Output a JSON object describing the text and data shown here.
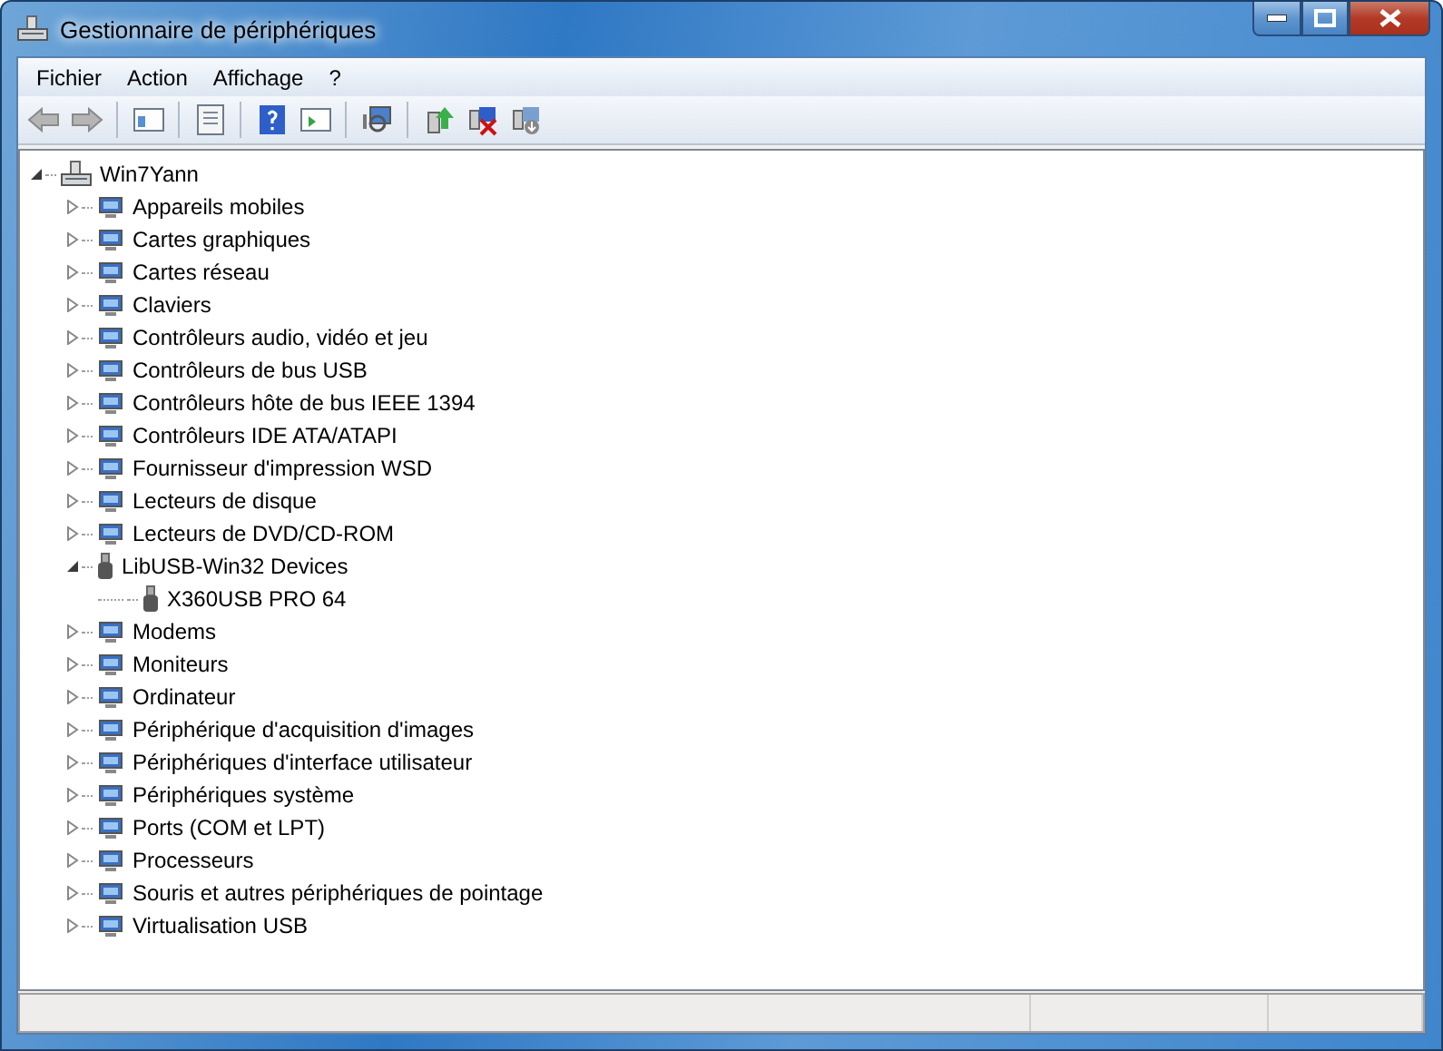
{
  "window": {
    "title": "Gestionnaire de périphériques"
  },
  "menu": [
    {
      "label": "Fichier"
    },
    {
      "label": "Action"
    },
    {
      "label": "Affichage"
    },
    {
      "label": "?"
    }
  ],
  "tree": [
    {
      "label": "Win7Yann",
      "expanded": true,
      "children": [
        {
          "label": "Appareils mobiles",
          "expanded": false
        },
        {
          "label": "Cartes graphiques",
          "expanded": false
        },
        {
          "label": "Cartes réseau",
          "expanded": false
        },
        {
          "label": "Claviers",
          "expanded": false
        },
        {
          "label": "Contrôleurs audio, vidéo et jeu",
          "expanded": false
        },
        {
          "label": "Contrôleurs de bus USB",
          "expanded": false
        },
        {
          "label": "Contrôleurs hôte de bus IEEE 1394",
          "expanded": false
        },
        {
          "label": "Contrôleurs IDE ATA/ATAPI",
          "expanded": false
        },
        {
          "label": "Fournisseur d'impression WSD",
          "expanded": false
        },
        {
          "label": "Lecteurs de disque",
          "expanded": false
        },
        {
          "label": "Lecteurs de DVD/CD-ROM",
          "expanded": false
        },
        {
          "label": "LibUSB-Win32 Devices",
          "expanded": true,
          "children": [
            {
              "label": "X360USB PRO 64"
            }
          ]
        },
        {
          "label": "Modems",
          "expanded": false
        },
        {
          "label": "Moniteurs",
          "expanded": false
        },
        {
          "label": "Ordinateur",
          "expanded": false
        },
        {
          "label": "Périphérique d'acquisition d'images",
          "expanded": false
        },
        {
          "label": "Périphériques d'interface utilisateur",
          "expanded": false
        },
        {
          "label": "Périphériques système",
          "expanded": false
        },
        {
          "label": "Ports (COM et LPT)",
          "expanded": false
        },
        {
          "label": "Processeurs",
          "expanded": false
        },
        {
          "label": "Souris et autres périphériques de pointage",
          "expanded": false
        },
        {
          "label": "Virtualisation USB",
          "expanded": false
        }
      ]
    }
  ]
}
